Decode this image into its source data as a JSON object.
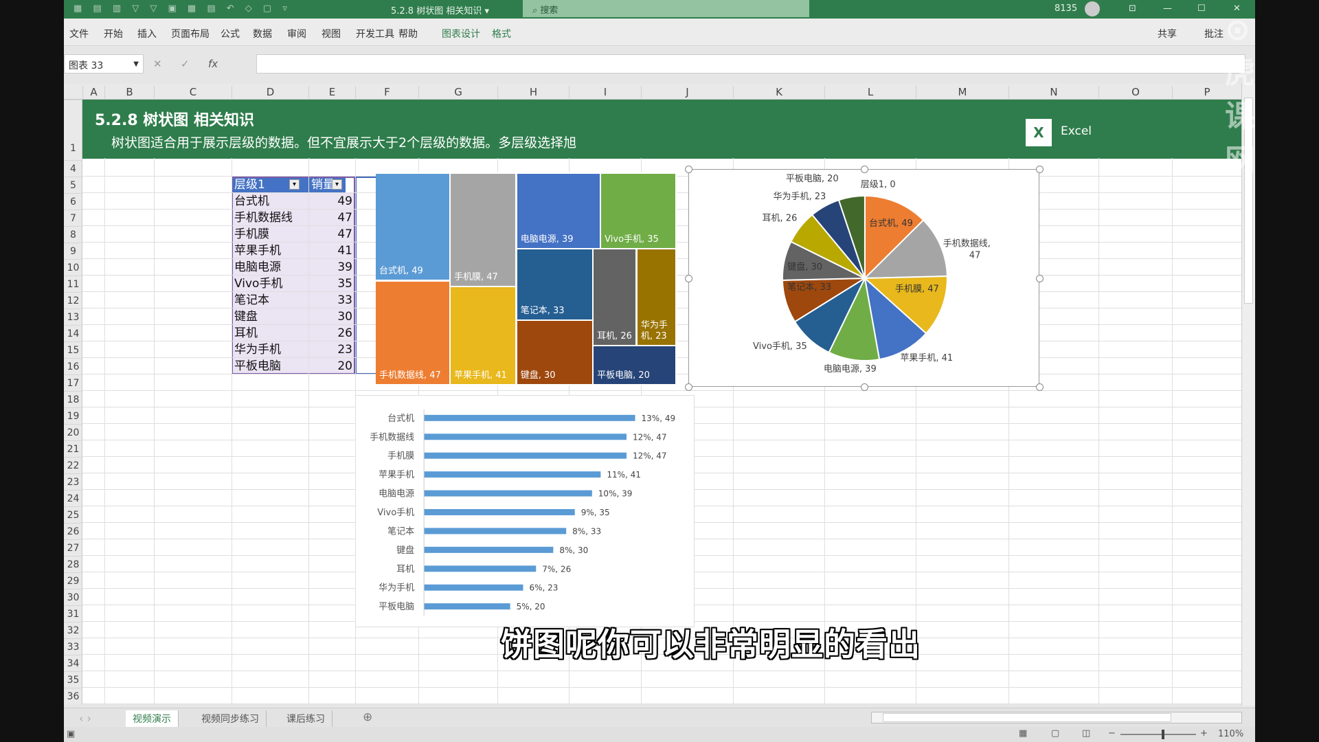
{
  "titlebar": {
    "doc_title": "5.2.8 树状图 相关知识 ▾",
    "search_placeholder": "搜索",
    "user_count": "8135"
  },
  "ribbon": {
    "tabs": [
      "文件",
      "开始",
      "插入",
      "页面布局",
      "公式",
      "数据",
      "审阅",
      "视图",
      "开发工具",
      "帮助",
      "图表设计",
      "格式"
    ],
    "share": "共享",
    "comment": "批注"
  },
  "formula_bar": {
    "name_box": "图表 33",
    "cancel": "✕",
    "confirm": "✓",
    "fx": "fx",
    "value": ""
  },
  "columns": [
    "A",
    "B",
    "C",
    "D",
    "E",
    "F",
    "G",
    "H",
    "I",
    "J",
    "K",
    "L",
    "M",
    "N",
    "O",
    "P"
  ],
  "rows": [
    "1",
    "4",
    "5",
    "6",
    "7",
    "8",
    "9",
    "10",
    "11",
    "12",
    "13",
    "14",
    "15",
    "16",
    "17",
    "18",
    "19",
    "20",
    "21",
    "22",
    "23",
    "24",
    "25",
    "26",
    "27",
    "28",
    "29",
    "30",
    "31",
    "32",
    "33",
    "34",
    "35",
    "36"
  ],
  "banner": {
    "title": "5.2.8 树状图 相关知识",
    "description": "树状图适合用于展示层级的数据。但不宜展示大于2个层级的数据。多层级选择旭",
    "logo_text": "Excel"
  },
  "table": {
    "headers": [
      "层级1",
      "销量"
    ],
    "rows": [
      {
        "name": "台式机",
        "value": 49,
        "pct": "13%"
      },
      {
        "name": "手机数据线",
        "value": 47,
        "pct": "12%"
      },
      {
        "name": "手机膜",
        "value": 47,
        "pct": "12%"
      },
      {
        "name": "苹果手机",
        "value": 41,
        "pct": "11%"
      },
      {
        "name": "电脑电源",
        "value": 39,
        "pct": "10%"
      },
      {
        "name": "Vivo手机",
        "value": 35,
        "pct": "9%"
      },
      {
        "name": "笔记本",
        "value": 33,
        "pct": "8%"
      },
      {
        "name": "键盘",
        "value": 30,
        "pct": "8%"
      },
      {
        "name": "耳机",
        "value": 26,
        "pct": "7%"
      },
      {
        "name": "华为手机",
        "value": 23,
        "pct": "6%"
      },
      {
        "name": "平板电脑",
        "value": 20,
        "pct": "5%"
      }
    ]
  },
  "chart_data": [
    {
      "type": "treemap",
      "categories": [
        "台式机",
        "手机数据线",
        "手机膜",
        "苹果手机",
        "电脑电源",
        "Vivo手机",
        "笔记本",
        "键盘",
        "耳机",
        "华为手机",
        "平板电脑"
      ],
      "values": [
        49,
        47,
        47,
        41,
        39,
        35,
        33,
        30,
        26,
        23,
        20
      ],
      "colors": [
        "#5b9bd5",
        "#ed7d31",
        "#a5a5a5",
        "#e8b81c",
        "#4472c4",
        "#70ad47",
        "#255e91",
        "#9e480e",
        "#636363",
        "#997300",
        "#264478"
      ]
    },
    {
      "type": "pie",
      "categories": [
        "层级1",
        "台式机",
        "手机数据线",
        "手机膜",
        "苹果手机",
        "电脑电源",
        "Vivo手机",
        "笔记本",
        "键盘",
        "耳机",
        "华为手机",
        "平板电脑"
      ],
      "values": [
        0,
        49,
        47,
        47,
        41,
        39,
        35,
        33,
        30,
        26,
        23,
        20
      ],
      "colors": [
        "#5b9bd5",
        "#ed7d31",
        "#a5a5a5",
        "#e8b81c",
        "#4472c4",
        "#70ad47",
        "#255e91",
        "#9e480e",
        "#636363",
        "#b8a800",
        "#264478",
        "#43682b"
      ],
      "labels": [
        "层级1, 0",
        "台式机, 49",
        "手机数据线,\n47",
        "手机膜, 47",
        "苹果手机, 41",
        "电脑电源, 39",
        "Vivo手机, 35",
        "笔记本, 33",
        "键盘, 30",
        "耳机, 26",
        "华为手机, 23",
        "平板电脑, 20"
      ]
    },
    {
      "type": "bar",
      "orientation": "horizontal",
      "categories": [
        "台式机",
        "手机数据线",
        "手机膜",
        "苹果手机",
        "电脑电源",
        "Vivo手机",
        "笔记本",
        "键盘",
        "耳机",
        "华为手机",
        "平板电脑"
      ],
      "values": [
        49,
        47,
        47,
        41,
        39,
        35,
        33,
        30,
        26,
        23,
        20
      ],
      "data_labels": [
        "13%, 49",
        "12%, 47",
        "12%, 47",
        "11%, 41",
        "10%, 39",
        "9%, 35",
        "8%, 33",
        "8%, 30",
        "7%, 26",
        "6%, 23",
        "5%, 20"
      ],
      "color": "#5b9bd5"
    }
  ],
  "sheet_tabs": [
    "视频演示",
    "视频同步练习",
    "课后练习"
  ],
  "status": {
    "zoom": "110%"
  },
  "subtitle": "饼图呢你可以非常明显的看出",
  "watermark": "虎课网"
}
